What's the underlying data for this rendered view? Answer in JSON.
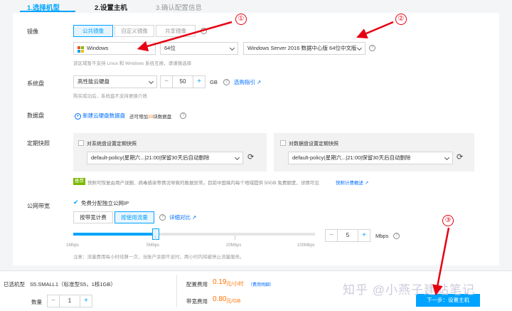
{
  "steps": [
    "1.选择机型",
    "2.设置主机",
    "3.确认配置信息"
  ],
  "image": {
    "label": "镜像",
    "tabs": [
      "公共镜像",
      "自定义镜像",
      "共享镜像"
    ],
    "os": "Windows",
    "bits": "64位",
    "version": "Windows Server 2016 数据中心版 64位中文版",
    "hint": "该区域暂不支持 Linux 和 Windows 系统互换，请谨慎选择"
  },
  "system_disk": {
    "label": "系统盘",
    "type": "高性能云硬盘",
    "size": "50",
    "unit": "GB",
    "link": "选购指引",
    "hint": "购买成功后，系统盘不支持更换介质"
  },
  "data_disk": {
    "label": "数据盘",
    "add_link": "新建云硬盘数据盘",
    "remaining_prefix": "还可增加",
    "remaining_count": "20",
    "remaining_suffix": "块数据盘"
  },
  "snapshot": {
    "label": "定期快照",
    "system_check": "对系统盘设置定期快照",
    "system_policy": "default-policy(星期六...|21:00|保留30天后自动删除",
    "data_check": "对数据盘设置定期快照",
    "data_policy": "default-policy(星期六...|21:00|保留30天后自动删除",
    "tag": "推荐",
    "hint": "快照可恢复由用户误删、病毒感染等情况导致的数据异常。目前中国境内每个地域提供 50GB 免费额度，详情可见",
    "hint_link": "快照计费概述"
  },
  "bandwidth": {
    "label": "公网带宽",
    "free_ip": "免费分配独立公网IP",
    "modes": [
      "按带宽计费",
      "按使用流量"
    ],
    "compare": "详细对比",
    "ticks": [
      "1Mbps",
      "5Mbps",
      "20Mbps",
      "100Mbps"
    ],
    "value": "5",
    "unit": "Mbps",
    "note": "注意：流量费用每小时结算一次，当账户余额不足时，两小时内将被停止流量服务。"
  },
  "footer": {
    "selected_label": "已选机型",
    "selected_value": "S5.SMALL1（标准型S5，1核1GB）",
    "qty_label": "数量",
    "qty": "1",
    "config_label": "配置费用",
    "config_price": "0.19",
    "config_unit": "元/小时",
    "config_note": "（费用明细）",
    "bw_label": "带宽费用",
    "bw_price": "0.80",
    "bw_unit": "元/GB",
    "next": "下一步：设置主机"
  },
  "annotations": [
    "①",
    "②",
    "③"
  ],
  "watermark": "知乎 @小燕子建站笔记",
  "colors": {
    "accent": "#00a4ff",
    "link": "#006eff",
    "price": "#ff7200",
    "annotation": "#e60012"
  }
}
